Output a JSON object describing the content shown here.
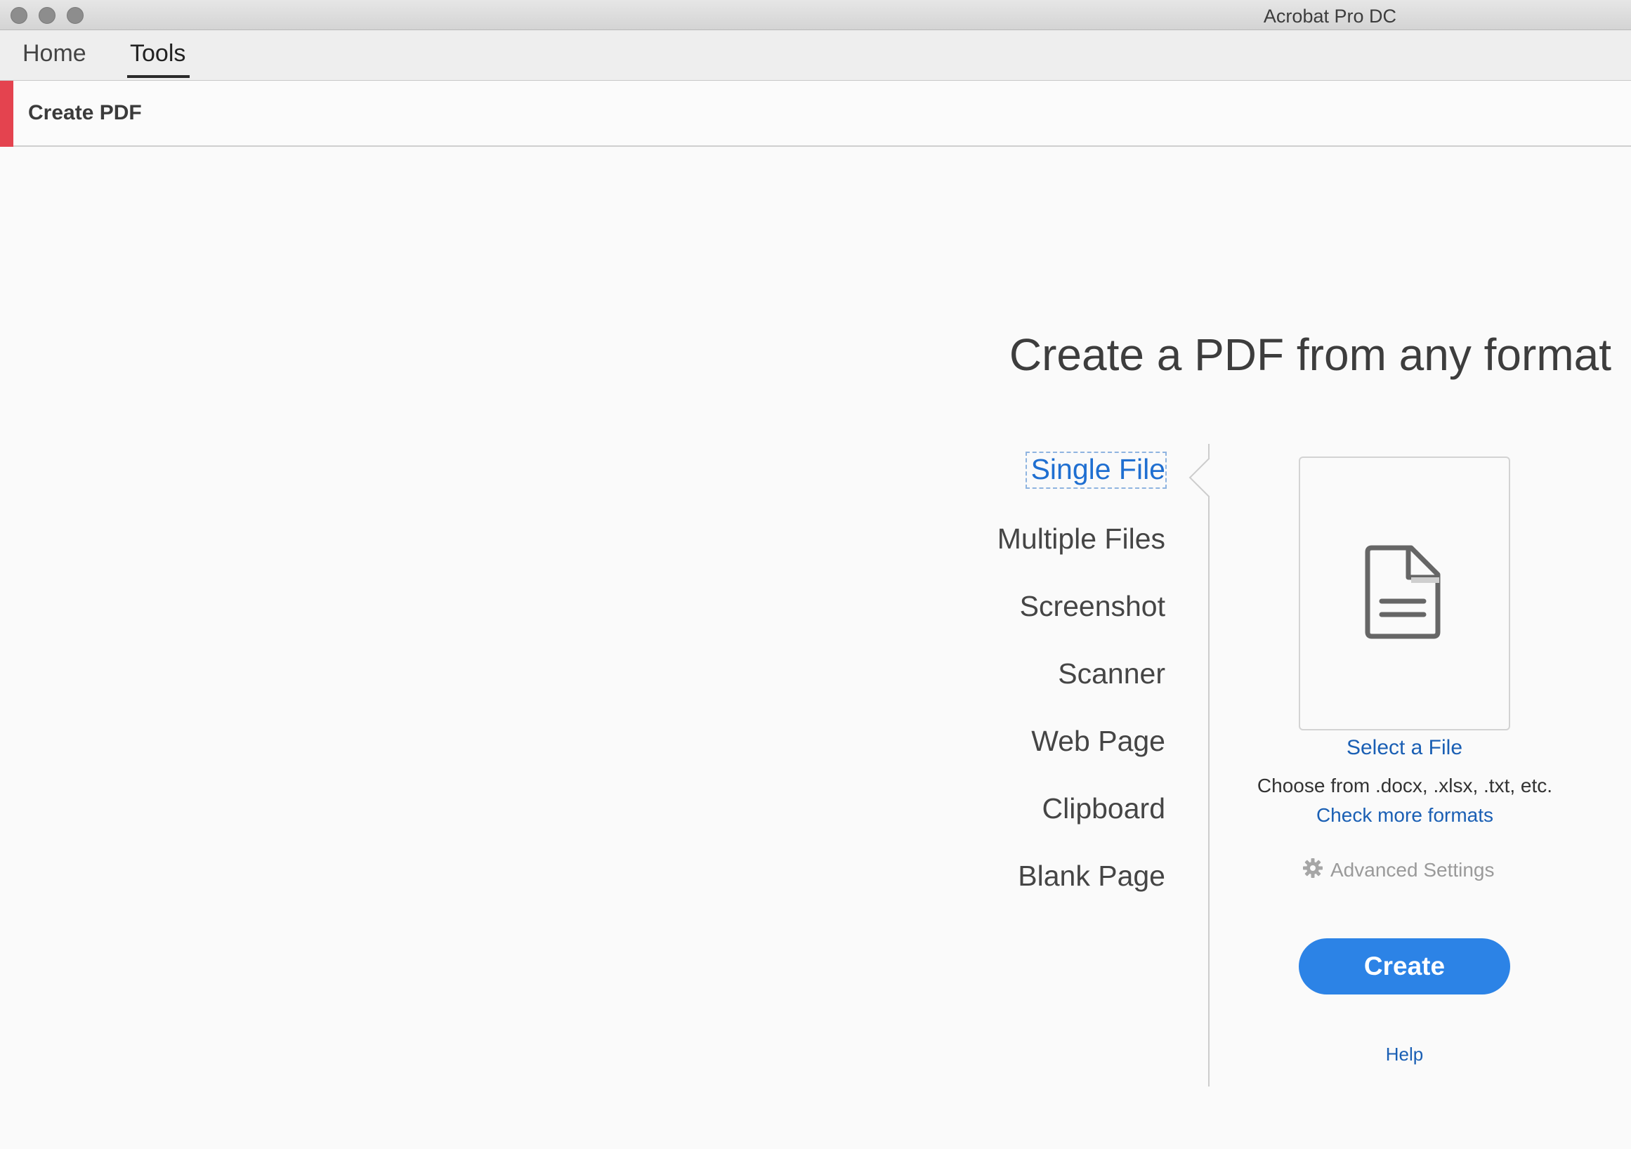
{
  "window": {
    "title": "Acrobat Pro DC"
  },
  "tabs": [
    {
      "label": "Home",
      "active": false
    },
    {
      "label": "Tools",
      "active": true
    }
  ],
  "tool": {
    "title": "Create PDF",
    "accent_color": "#e4434f"
  },
  "main": {
    "heading": "Create a PDF from any format",
    "options": [
      {
        "label": "Single File",
        "selected": true
      },
      {
        "label": "Multiple Files",
        "selected": false
      },
      {
        "label": "Screenshot",
        "selected": false
      },
      {
        "label": "Scanner",
        "selected": false
      },
      {
        "label": "Web Page",
        "selected": false
      },
      {
        "label": "Clipboard",
        "selected": false
      },
      {
        "label": "Blank Page",
        "selected": false
      }
    ],
    "file_panel": {
      "icon": "document-icon",
      "select_link": "Select a File",
      "formats_text": "Choose from .docx, .xlsx, .txt, etc.",
      "more_formats_link": "Check more formats",
      "advanced_settings": "Advanced Settings",
      "advanced_icon": "gear-icon",
      "create_button": "Create",
      "help_link": "Help"
    }
  },
  "colors": {
    "primary_button": "#2c83e6",
    "link": "#1a5fb4",
    "selected_option": "#1f6fd1"
  }
}
